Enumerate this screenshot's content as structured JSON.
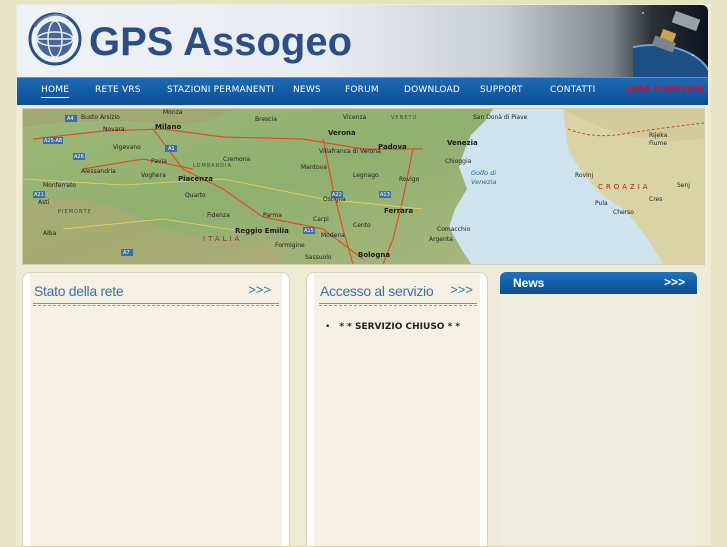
{
  "header": {
    "brand": "GPS Assogeo"
  },
  "nav": {
    "items": [
      {
        "label": "HOME"
      },
      {
        "label": "RETE VRS"
      },
      {
        "label": "STAZIONI PERMANENTI"
      },
      {
        "label": "NEWS"
      },
      {
        "label": "FORUM"
      },
      {
        "label": "DOWNLOAD"
      },
      {
        "label": "SUPPORT"
      },
      {
        "label": "CONTATTI"
      },
      {
        "label": "AREA RISERVATA"
      }
    ],
    "active": "HOME",
    "highlight_color": "#c8102e"
  },
  "map": {
    "cities": [
      "Monza",
      "Busto Arsizio",
      "Novara",
      "Milano",
      "Vigevano",
      "Pavia",
      "Voghera",
      "Alessandria",
      "Monferrato",
      "Asti",
      "Alba",
      "Brescia",
      "Mantova",
      "Cremona",
      "Piacenza",
      "Parma",
      "Fidenza",
      "Reggio Emilia",
      "Carpi",
      "Modena",
      "Formigine",
      "Sassuolo",
      "Bologna",
      "Cento",
      "Ferrara",
      "Verona",
      "Legnago",
      "Rovigo",
      "Padova",
      "Vicenza",
      "Venezia",
      "Chioggia",
      "San Donà di Piave",
      "Comacchio",
      "Argenta",
      "Ostiglia",
      "Villafranca di Verona",
      "Rijeka",
      "Fiume",
      "Rovinj",
      "Pula",
      "Cres",
      "Senj",
      "Cherso",
      "Quarto"
    ],
    "regions": [
      "LOMBARDIA",
      "VENETO",
      "PIEMONTE",
      "ITALIA",
      "CROAZIA"
    ],
    "sea_label": [
      "Golfo di",
      "Venezia"
    ],
    "road_labels": [
      "A4",
      "A26",
      "A21",
      "A1",
      "A22",
      "A13",
      "A7",
      "A25-A8",
      "A8",
      "A15"
    ]
  },
  "panels": {
    "stato": {
      "title": "Stato della rete",
      "more": ">>>"
    },
    "accesso": {
      "title": "Accesso al servizio",
      "more": ">>>",
      "items": [
        "* * SERVIZIO CHIUSO * *"
      ]
    },
    "news": {
      "title": "News",
      "more": ">>>"
    }
  },
  "colors": {
    "nav_blue": "#0c4f97",
    "brand_blue": "#2c4e86",
    "panel_title": "#3b6fa6",
    "page_bg": "#e6e2c6"
  }
}
